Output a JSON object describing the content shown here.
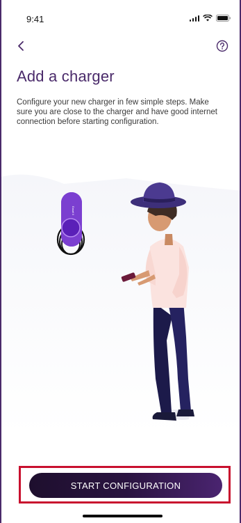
{
  "status_bar": {
    "time": "9:41"
  },
  "header": {
    "title": "Add a charger"
  },
  "main": {
    "description": "Configure your new charger in few simple steps. Make sure you are close to the charger and have good internet connection before starting configuration.",
    "charger_label": "Easel II"
  },
  "footer": {
    "cta_label": "START CONFIGURATION"
  },
  "colors": {
    "accent": "#4a2a6a",
    "charger_purple": "#7b3fd0",
    "highlight": "#c8102e"
  },
  "icons": {
    "back": "chevron-left-icon",
    "help": "question-circle-icon"
  }
}
